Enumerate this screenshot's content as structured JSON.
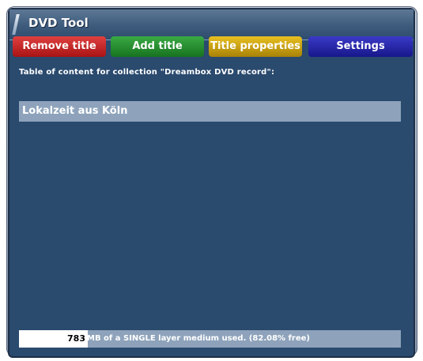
{
  "window": {
    "title": "DVD Tool"
  },
  "buttons": {
    "red": "Remove title",
    "green": "Add title",
    "yellow": "Title properties",
    "blue": "Settings"
  },
  "toc_label": "Table of content for collection \"Dreambox DVD record\":",
  "titles": [
    {
      "name": "Lokalzeit aus Köln"
    }
  ],
  "status": {
    "used_mb": "783",
    "text": "MB of a SINGLE layer medium used. (82.08% free)",
    "used_fraction": 0.1792
  },
  "colors": {
    "background": "#2a4a6e",
    "red_button": "#c82020",
    "green_button": "#2a8f33",
    "yellow_button": "#d4aa10",
    "blue_button": "#2828a8",
    "selection": "#8ea3bb"
  }
}
